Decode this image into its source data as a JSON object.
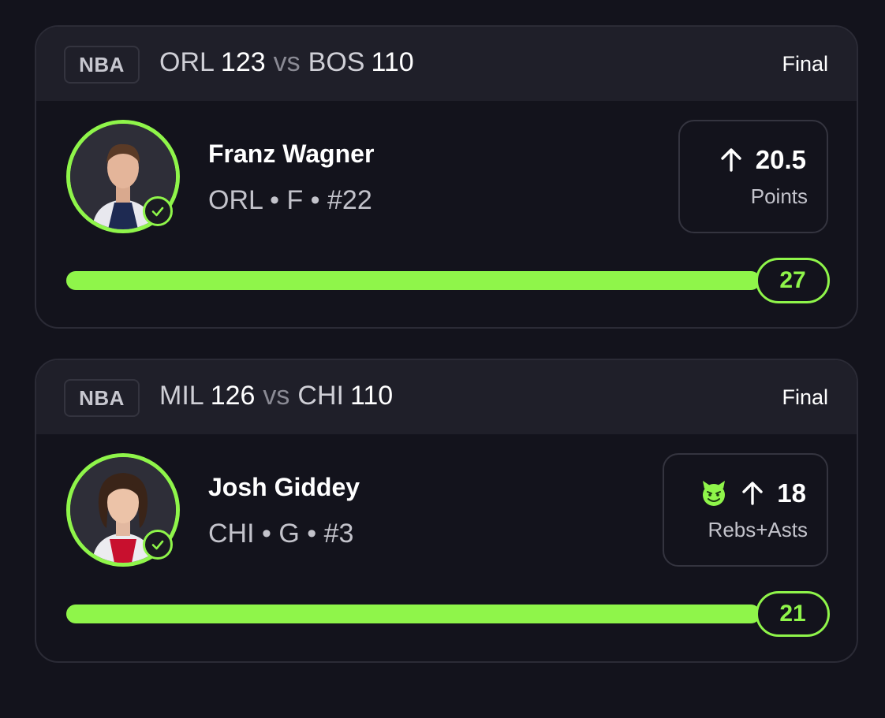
{
  "colors": {
    "background": "#13131c",
    "header": "#1f1f29",
    "accent": "#8ff54a",
    "muted_text": "#c3c3cb"
  },
  "cards": [
    {
      "league": "NBA",
      "away_team": "ORL",
      "away_score": "123",
      "vs": "vs",
      "home_team": "BOS",
      "home_score": "110",
      "status": "Final",
      "player": {
        "name": "Franz Wagner",
        "meta": "ORL • F • #22",
        "avatar": "player-headshot",
        "verified_icon": "check-icon"
      },
      "line": {
        "direction_icon": "arrow-up-icon",
        "value": "20.5",
        "stat": "Points",
        "extra_icon": null
      },
      "result": {
        "value": "27",
        "progress_fraction": 1.0
      }
    },
    {
      "league": "NBA",
      "away_team": "MIL",
      "away_score": "126",
      "vs": "vs",
      "home_team": "CHI",
      "home_score": "110",
      "status": "Final",
      "player": {
        "name": "Josh Giddey",
        "meta": "CHI • G • #3",
        "avatar": "player-headshot",
        "verified_icon": "check-icon"
      },
      "line": {
        "direction_icon": "arrow-up-icon",
        "value": "18",
        "stat": "Rebs+Asts",
        "extra_icon": "devil-emoji-icon"
      },
      "result": {
        "value": "21",
        "progress_fraction": 1.0
      }
    }
  ]
}
